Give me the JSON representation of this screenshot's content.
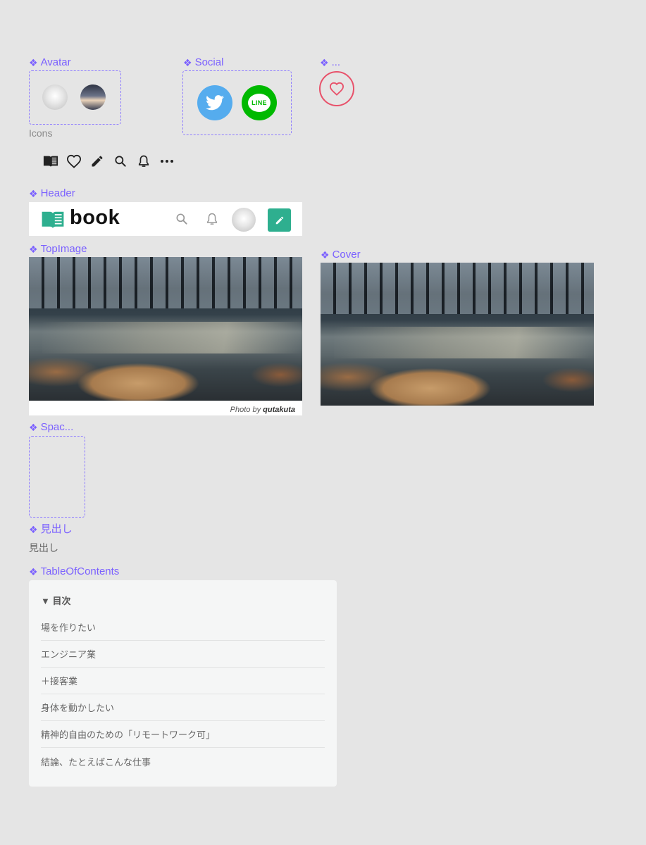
{
  "components": {
    "avatar": "Avatar",
    "social": "Social",
    "ellipsis": "...",
    "header": "Header",
    "top_image": "TopImage",
    "cover": "Cover",
    "spacer": "Spac...",
    "heading": "見出し",
    "toc": "TableOfContents"
  },
  "icons_label": "Icons",
  "icons": [
    "book-icon",
    "heart-icon",
    "pencil-icon",
    "search-icon",
    "bell-icon",
    "more-icon"
  ],
  "social": {
    "line_text": "LINE"
  },
  "header": {
    "logo": "book"
  },
  "top_image": {
    "caption_prefix": "Photo by",
    "caption_author": "qutakuta"
  },
  "heading_text": "見出し",
  "toc": {
    "title": "▼ 目次",
    "items": [
      "場を作りたい",
      "エンジニア業",
      "＋接客業",
      "身体を動かしたい",
      "精神的自由のための「リモートワーク可」",
      "結論、たとえばこんな仕事"
    ]
  },
  "colors": {
    "component_label": "#7b61ff",
    "twitter": "#55acee",
    "line": "#00b900",
    "accent_green": "#2eaf8f",
    "heart": "#e8516a"
  }
}
